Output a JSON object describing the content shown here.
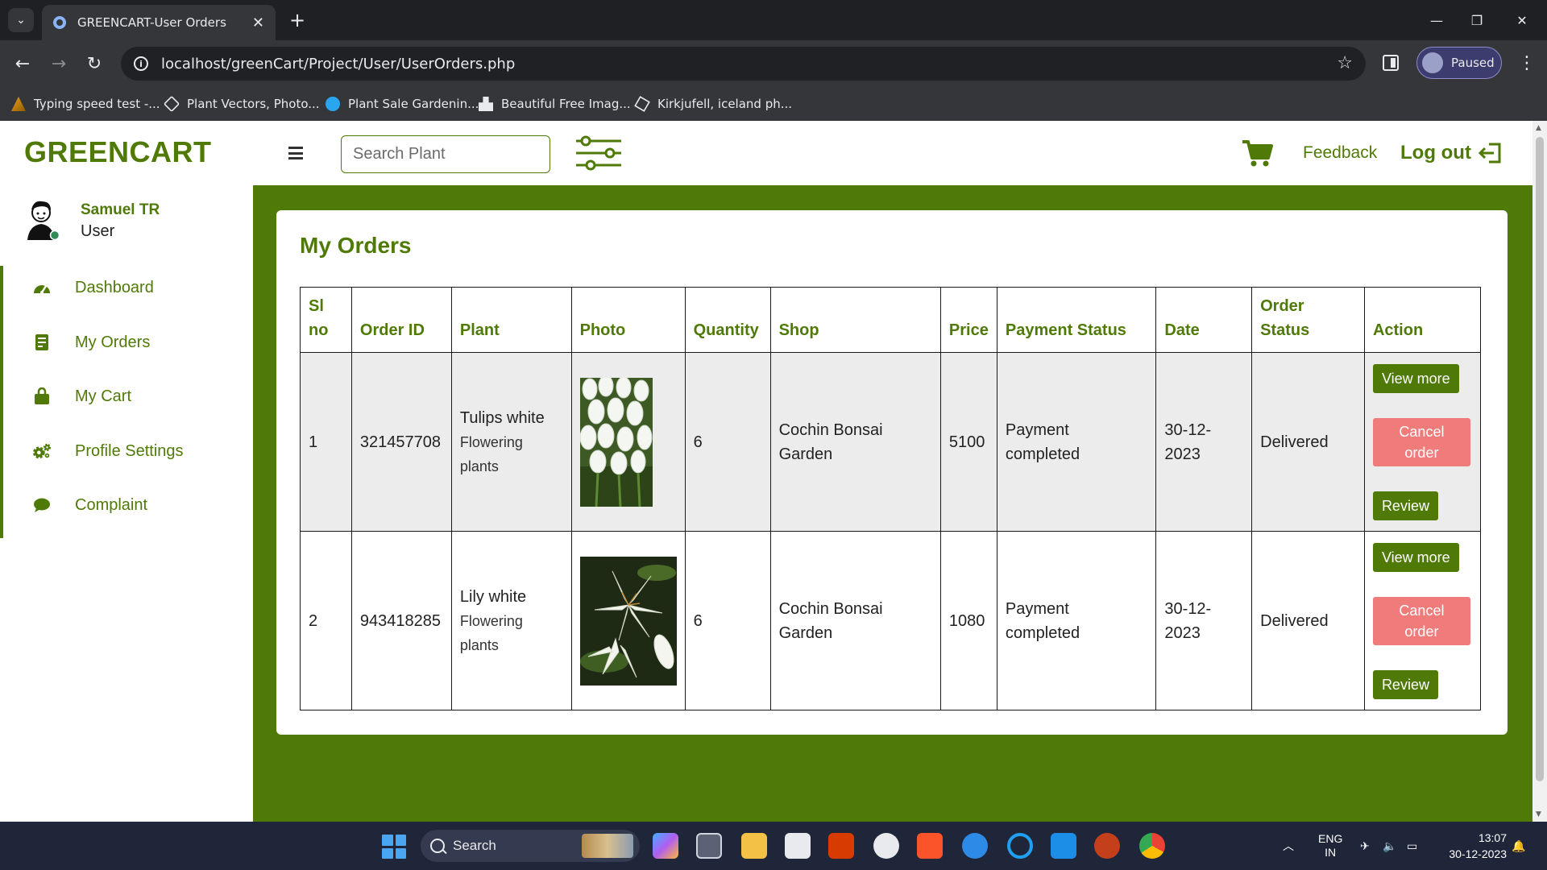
{
  "browser": {
    "tab_title": "GREENCART-User Orders",
    "url": "localhost/greenCart/Project/User/UserOrders.php",
    "profile_status": "Paused",
    "bookmarks": [
      {
        "label": "Typing speed test -...",
        "icon": "typing-icon"
      },
      {
        "label": "Plant Vectors, Photo...",
        "icon": "freepik-icon"
      },
      {
        "label": "Plant Sale Gardenin...",
        "icon": "search-bookmark-icon"
      },
      {
        "label": "Beautiful Free Imag...",
        "icon": "unsplash-icon"
      },
      {
        "label": "Kirkjufell, iceland ph...",
        "icon": "cube-icon"
      }
    ]
  },
  "header": {
    "brand": "GREENCART",
    "search_placeholder": "Search Plant",
    "feedback": "Feedback",
    "logout": "Log out"
  },
  "sidebar": {
    "user_name": "Samuel TR",
    "user_role": "User",
    "items": [
      {
        "label": "Dashboard",
        "icon": "dashboard-icon"
      },
      {
        "label": "My Orders",
        "icon": "orders-icon"
      },
      {
        "label": "My Cart",
        "icon": "bag-icon"
      },
      {
        "label": "Profile Settings",
        "icon": "gears-icon"
      },
      {
        "label": "Complaint",
        "icon": "chat-icon"
      }
    ]
  },
  "orders": {
    "title": "My Orders",
    "columns": [
      "Sl no",
      "Order ID",
      "Plant",
      "Photo",
      "Quantity",
      "Shop",
      "Price",
      "Payment Status",
      "Date",
      "Order Status",
      "Action"
    ],
    "rows": [
      {
        "sl": "1",
        "order_id": "321457708",
        "plant": "Tulips white",
        "category": "Flowering plants",
        "quantity": "6",
        "shop": "Cochin Bonsai Garden",
        "price": "5100",
        "payment_status": "Payment completed",
        "date": "30-12-2023",
        "order_status": "Delivered"
      },
      {
        "sl": "2",
        "order_id": "943418285",
        "plant": "Lily white",
        "category": "Flowering plants",
        "quantity": "6",
        "shop": "Cochin Bonsai Garden",
        "price": "1080",
        "payment_status": "Payment completed",
        "date": "30-12-2023",
        "order_status": "Delivered"
      }
    ],
    "actions": {
      "view_more": "View more",
      "cancel": "Cancel order",
      "review": "Review"
    }
  },
  "taskbar": {
    "search_label": "Search",
    "lang": "ENG",
    "region": "IN",
    "time": "13:07",
    "date": "30-12-2023"
  },
  "colors": {
    "brand_green": "#4f7a07",
    "cancel_red": "#ef7b7b",
    "payment_blue": "#1a1a9c",
    "status_purple": "#7a1f7a"
  }
}
